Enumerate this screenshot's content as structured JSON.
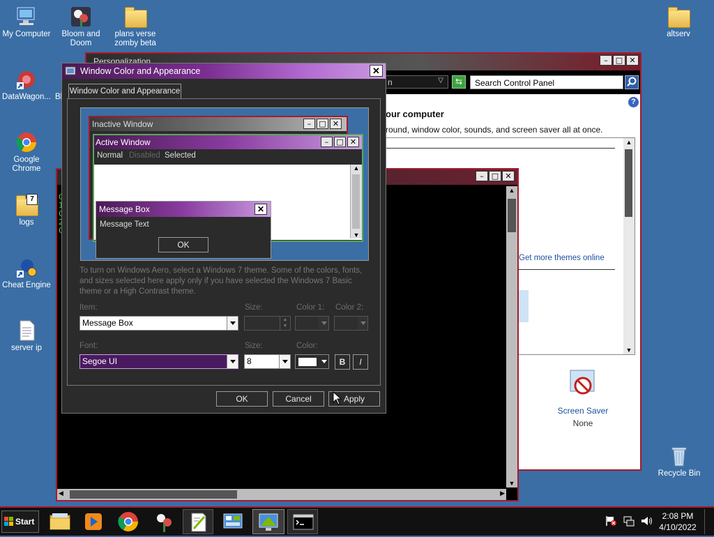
{
  "desktop": {
    "icons": [
      {
        "label": "My Computer",
        "icon": "computer-icon"
      },
      {
        "label": "Bloom and Doom",
        "icon": "flower-app-icon"
      },
      {
        "label": "plans verse zomby beta",
        "icon": "folder-icon"
      },
      {
        "label": "altserv",
        "icon": "folder-icon"
      },
      {
        "label": "DataWagon...",
        "icon": "shortcut-icon"
      },
      {
        "label": "Bl",
        "icon": "shortcut-icon"
      },
      {
        "label": "Google Chrome",
        "icon": "chrome-icon"
      },
      {
        "label": "logs",
        "icon": "folder-icon"
      },
      {
        "label": "Cheat Engine",
        "icon": "cheat-engine-icon"
      },
      {
        "label": "server ip",
        "icon": "text-file-icon"
      },
      {
        "label": "Recycle Bin",
        "icon": "recycle-bin-icon"
      }
    ]
  },
  "personalization": {
    "title_fragment": "Personalization",
    "address_fragment": "n",
    "search_placeholder": "Search Control Panel",
    "heading_fragment": "our computer",
    "subtext_fragment": "round, window color, sounds, and screen saver all at once.",
    "more_themes_link": "Get more themes online",
    "screen_saver_label": "Screen Saver",
    "screen_saver_value": "None"
  },
  "console": {
    "left_chars": [
      "C",
      "1",
      "C",
      "2",
      "C"
    ]
  },
  "dialog": {
    "title": "Window Color and Appearance",
    "tab_label": "Window Color and Appearance",
    "preview": {
      "inactive_title": "Inactive Window",
      "active_title": "Active Window",
      "menu_items": [
        {
          "label": "Normal",
          "state": "normal"
        },
        {
          "label": "Disabled",
          "state": "disabled"
        },
        {
          "label": "Selected",
          "state": "selected"
        }
      ],
      "msgbox_title": "Message Box",
      "msgbox_text": "Message Text",
      "msgbox_ok": "OK"
    },
    "info_text": "To turn on Windows Aero, select a Windows 7 theme.  Some of the colors, fonts, and sizes selected here apply only if you have selected the Windows 7 Basic theme or a High Contrast theme.",
    "item_label": "Item:",
    "item_value": "Message Box",
    "size_label": "Size:",
    "color1_label": "Color 1:",
    "color2_label": "Color 2:",
    "font_label": "Font:",
    "font_value": "Segoe UI",
    "font_size_label": "Size:",
    "font_size_value": "8",
    "color_label": "Color:",
    "bold_label": "B",
    "italic_label": "I",
    "ok_label": "OK",
    "cancel_label": "Cancel",
    "apply_label": "Apply"
  },
  "taskbar": {
    "start_label": "Start",
    "clock_time": "2:08 PM",
    "clock_date": "4/10/2022"
  },
  "colors": {
    "accent_border": "#a81a2c",
    "dialog_title_start": "#4a1a55",
    "dialog_title_end": "#c99ae0",
    "desktop": "#3a6ea5"
  }
}
